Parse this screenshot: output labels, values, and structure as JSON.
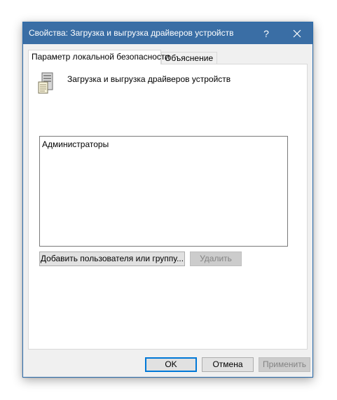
{
  "window": {
    "title": "Свойства: Загрузка и выгрузка драйверов устройств",
    "help_label": "?",
    "close_icon": "close-icon"
  },
  "tabs": [
    {
      "label": "Параметр локальной безопасности",
      "active": true
    },
    {
      "label": "Объяснение",
      "active": false
    }
  ],
  "policy": {
    "icon": "server-policy-icon",
    "name": "Загрузка и выгрузка драйверов устройств"
  },
  "assigned_list": {
    "items": [
      "Администраторы"
    ]
  },
  "actions": {
    "add_label": "Добавить пользователя или группу...",
    "remove_label": "Удалить"
  },
  "footer": {
    "ok_label": "OK",
    "cancel_label": "Отмена",
    "apply_label": "Применить"
  },
  "colors": {
    "titlebar": "#3a6ea5",
    "window_bg": "#f0f0f0",
    "default_button_border": "#0078d7"
  }
}
